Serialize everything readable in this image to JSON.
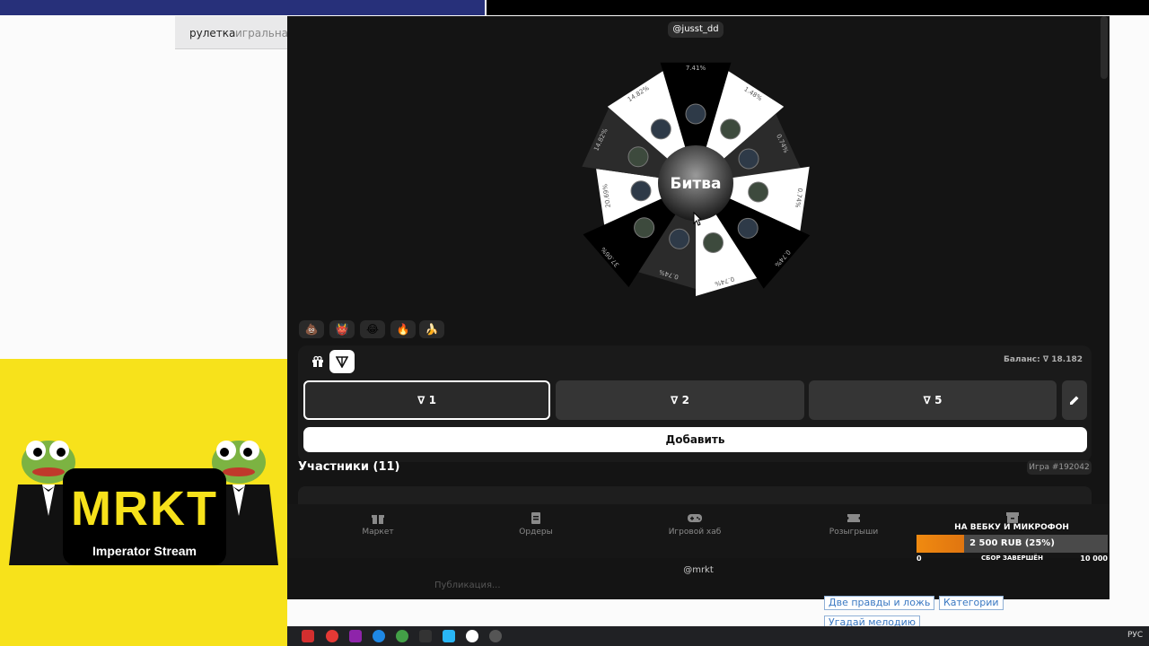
{
  "background_page": {
    "tabs": [
      "рулетка",
      "игральная"
    ],
    "chips": [
      "Две правды и ложь",
      "Категории",
      "Угадай мелодию"
    ]
  },
  "overlay": {
    "logo_big": "MRKT",
    "logo_small": "Imperator Stream"
  },
  "app": {
    "user_tag": "@jusst_dd",
    "wheel": {
      "center_label": "Битва",
      "segments": [
        {
          "percent": "7.41%",
          "color": "#000000"
        },
        {
          "percent": "1.48%",
          "color": "#ffffff"
        },
        {
          "percent": "0.74%",
          "color": "#2b2b2b"
        },
        {
          "percent": "0.74%",
          "color": "#ffffff"
        },
        {
          "percent": "0.74%",
          "color": "#000000"
        },
        {
          "percent": "0.74%",
          "color": "#ffffff"
        },
        {
          "percent": "0.74%",
          "color": "#2b2b2b"
        },
        {
          "percent": "37.06%",
          "color": "#000000"
        },
        {
          "percent": "20.69%",
          "color": "#ffffff"
        },
        {
          "percent": "14.82%",
          "color": "#2b2b2b"
        },
        {
          "percent": "14.82%",
          "color": "#ffffff"
        }
      ]
    },
    "emojis": [
      "💩",
      "👹",
      "😂",
      "🔥",
      "🍌"
    ],
    "balance": "Баланс: ∇ 18.182",
    "amounts": [
      "∇ 1",
      "∇ 2",
      "∇ 5"
    ],
    "add_label": "Добавить",
    "participants_title": "Участники (11)",
    "game_id": "Игра #192042",
    "nav": [
      "Маркет",
      "Ордеры",
      "Игровой хаб",
      "Розыгрыши"
    ],
    "footer_handle": "@mrkt",
    "chat_placeholder": "Публикация..."
  },
  "goal": {
    "title": "НА ВЕБКУ И МИКРОФОН",
    "progress_text": "2 500 RUB (25%)",
    "progress_fraction": 0.25,
    "min": "0",
    "status": "СБОР ЗАВЕРШЁН",
    "max": "10 000"
  },
  "taskbar": {
    "lang": "РУС"
  },
  "colors": {
    "overlay_yellow": "#f7e21b",
    "app_bg": "#141414",
    "goal_orange": "#f08a10"
  }
}
